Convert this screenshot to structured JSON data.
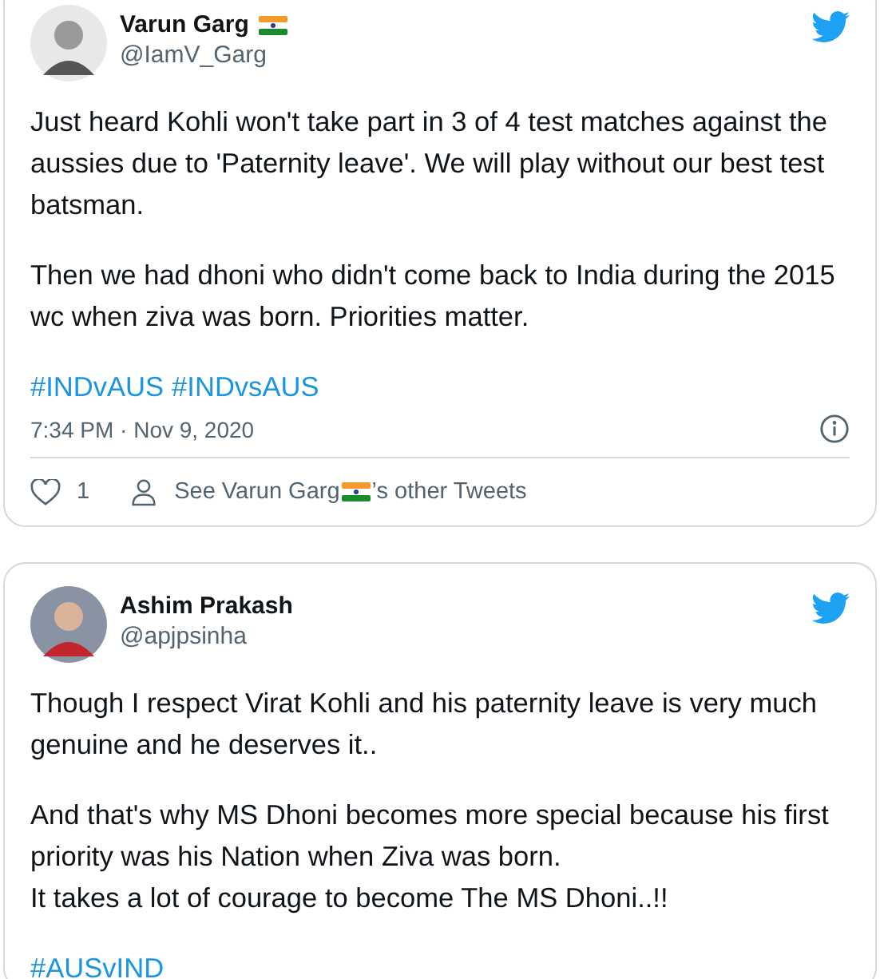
{
  "tweets": [
    {
      "name": "Varun Garg",
      "flag": true,
      "handle": "@IamV_Garg",
      "paragraphs": [
        "Just heard Kohli won't take part in 3 of 4 test matches against the aussies due to 'Paternity leave'. We will play without our best test batsman.",
        "Then we had dhoni who didn't come back to India during the 2015 wc when ziva was born. Priorities matter."
      ],
      "hashtags": [
        "#INDvAUS",
        "#INDvsAUS"
      ],
      "time": "7:34 PM · Nov 9, 2020",
      "likes": "1",
      "other_tweets": [
        "See Varun Garg",
        "’s other Tweets"
      ]
    },
    {
      "name": "Ashim Prakash",
      "flag": false,
      "handle": "@apjpsinha",
      "paragraphs": [
        "Though I respect Virat Kohli and his paternity leave is very much genuine and he deserves it..",
        "And that's why MS Dhoni becomes more special because his first priority was his Nation when Ziva was born.\nIt takes a lot of courage to become The MS Dhoni..!!"
      ],
      "hashtags": [
        "#AUSvIND"
      ]
    }
  ]
}
